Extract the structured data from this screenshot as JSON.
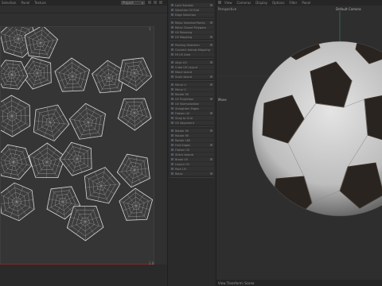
{
  "uv_editor": {
    "menu": [
      "Selection",
      "Panel",
      "Texture"
    ],
    "layer_select": "Project",
    "corner_top_right": "1",
    "corner_bottom_right": "1.0"
  },
  "tools": {
    "groups": [
      [
        "Lock Solution",
        "Selection UV Edit",
        "Edge Selection"
      ],
      [
        "Relax Selected Points",
        "Relax Closed Polygons",
        "UV Relaxing",
        "UV Mapping"
      ],
      [
        "Packing Selection",
        "Connect Islands Mapping",
        "Fit UV Area"
      ],
      [
        "Align UV",
        "Cube UV Layout",
        "Move Island",
        "Scale Island"
      ],
      [
        "Mirror U",
        "Mirror V",
        "Rotate 90",
        "UV Projection",
        "UV Normalization",
        "Straighten Edges",
        "Flatten UV",
        "Snap to Grid",
        "UV Alignment"
      ],
      [
        "Rotate 90",
        "Rotate 90",
        "Rotate 180",
        "Fold Edges",
        "Flatten UV",
        "Stitch Islands",
        "Break UV",
        "Layout UV",
        "Pack UV",
        "Relax"
      ]
    ]
  },
  "viewport": {
    "menu": [
      "View",
      "Cameras",
      "Display",
      "Options",
      "Filter",
      "Panel"
    ],
    "view_name": "Perspective",
    "camera": "Default Camera",
    "tool_label": "Move",
    "status": "View Transform: Scene"
  },
  "colors": {
    "accent": "#4c5a6a",
    "uv_wire": "#d8d8d8",
    "ball_white": "#d6d6d6",
    "ball_black": "#2a2420"
  }
}
